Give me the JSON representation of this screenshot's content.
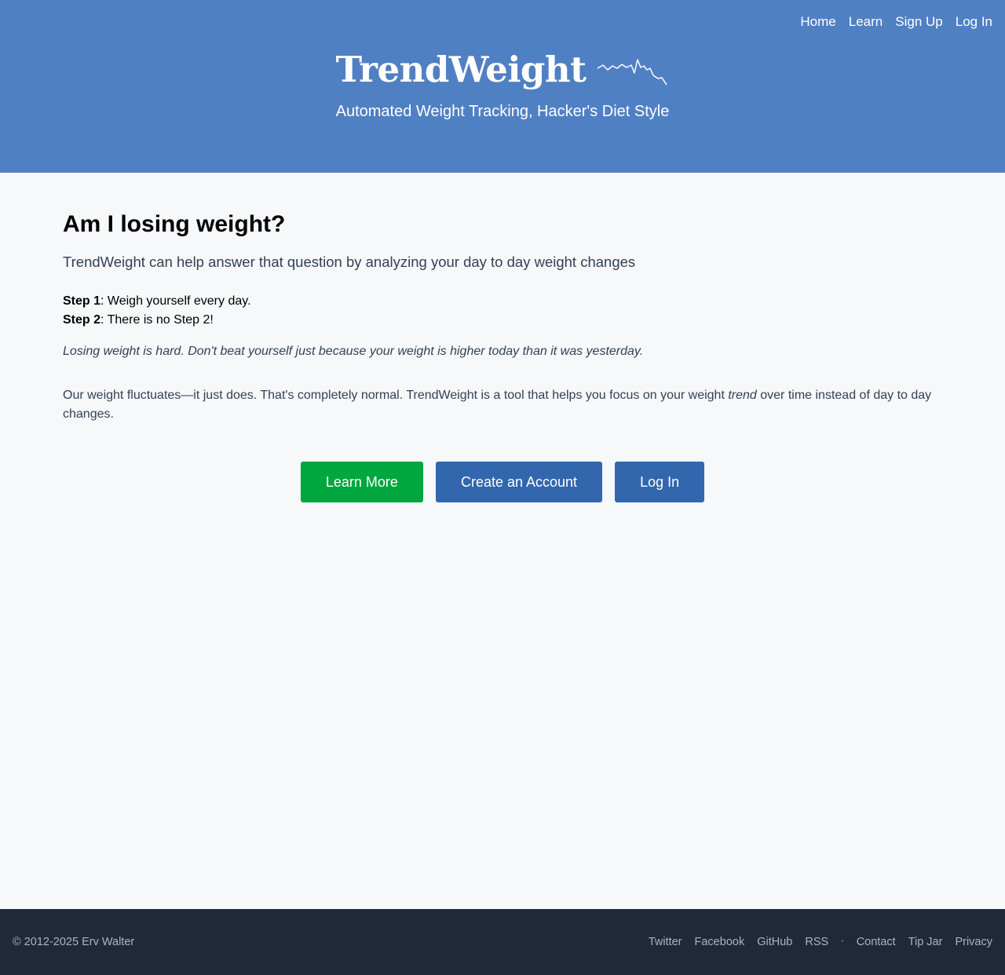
{
  "nav": {
    "home": "Home",
    "learn": "Learn",
    "signup": "Sign Up",
    "login": "Log In"
  },
  "brand": {
    "title": "TrendWeight",
    "tagline": "Automated Weight Tracking, Hacker's Diet Style",
    "logo_icon": "sparkline-icon"
  },
  "main": {
    "heading": "Am I losing weight?",
    "lead": "TrendWeight can help answer that question by analyzing your day to day weight changes",
    "step1_label": "Step 1",
    "step1_text": ": Weigh yourself every day.",
    "step2_label": "Step 2",
    "step2_text": ": There is no Step 2!",
    "note": "Losing weight is hard. Don't beat yourself just because your weight is higher today than it was yesterday.",
    "body_before": "Our weight fluctuates—it just does. That's completely normal. TrendWeight is a tool that helps you focus on your weight ",
    "body_em": "trend",
    "body_after": " over time instead of day to day changes."
  },
  "buttons": {
    "learn_more": "Learn More",
    "create_account": "Create an Account",
    "login": "Log In"
  },
  "footer": {
    "copyright": "© 2012-2025 Erv Walter",
    "twitter": "Twitter",
    "facebook": "Facebook",
    "github": "GitHub",
    "rss": "RSS",
    "separator": "•",
    "contact": "Contact",
    "tipjar": "Tip Jar",
    "privacy": "Privacy"
  },
  "colors": {
    "header_bg": "#5080c4",
    "page_bg": "#f6f8fa",
    "green_button": "#00a63e",
    "blue_button": "#3267ad",
    "footer_bg": "#1f2939"
  }
}
